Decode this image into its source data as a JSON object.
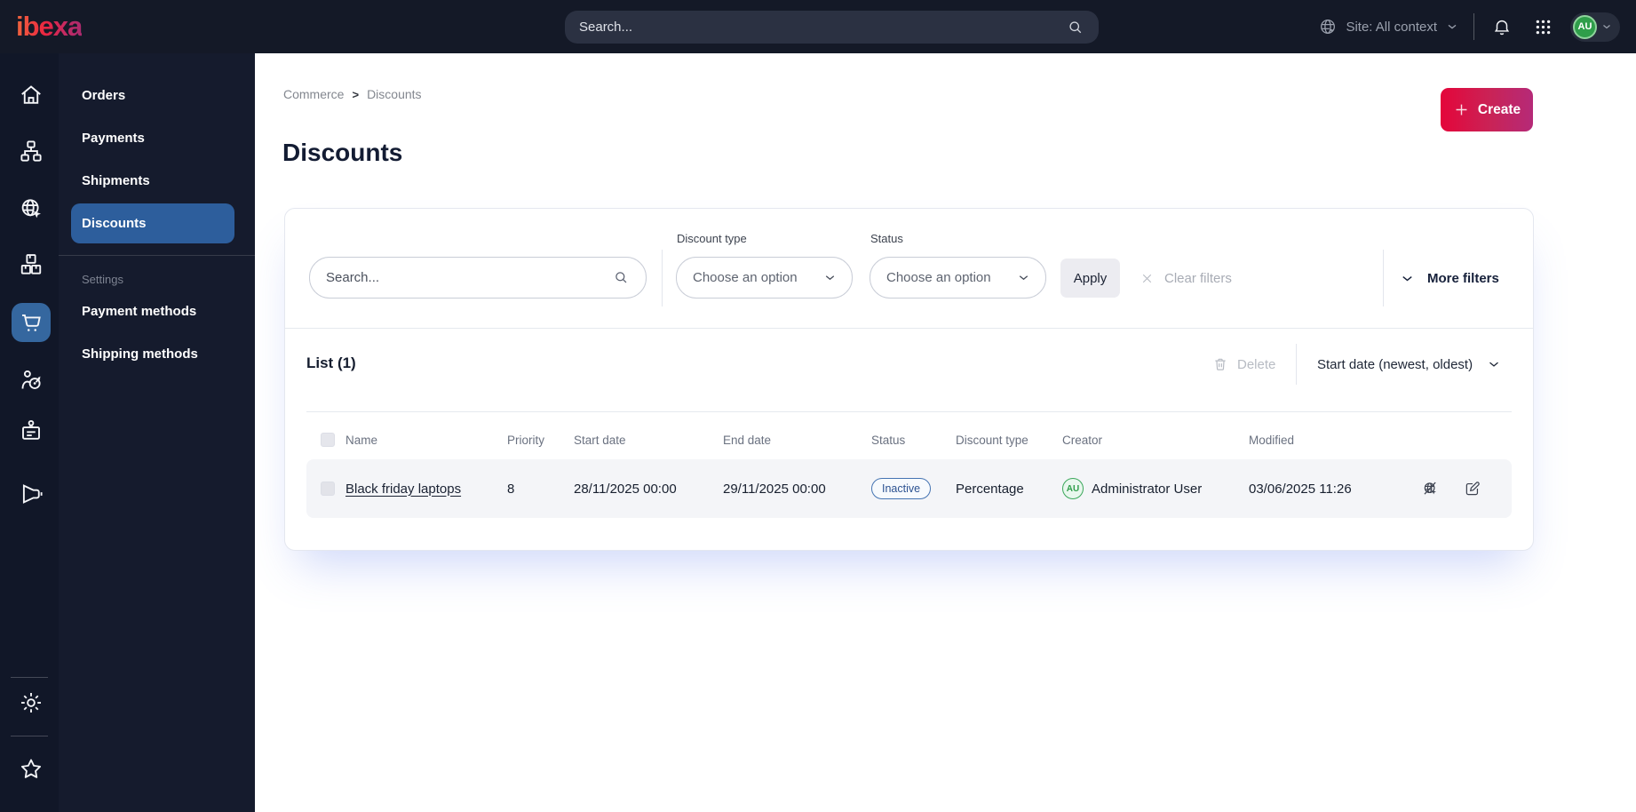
{
  "topbar": {
    "logo_text": "ibexa",
    "search_placeholder": "Search...",
    "site_context_label": "Site: All context",
    "avatar_initials": "AU"
  },
  "rail": {
    "icons": [
      "home",
      "content-tree",
      "site-globe",
      "products",
      "commerce-cart",
      "customers-target",
      "id-badge",
      "megaphone",
      "settings-gear",
      "bookmarks-star"
    ],
    "active_icon": "commerce-cart"
  },
  "menu": {
    "items": [
      {
        "label": "Orders",
        "active": false
      },
      {
        "label": "Payments",
        "active": false
      },
      {
        "label": "Shipments",
        "active": false
      },
      {
        "label": "Discounts",
        "active": true
      }
    ],
    "section_label": "Settings",
    "section_items": [
      {
        "label": "Payment methods"
      },
      {
        "label": "Shipping methods"
      }
    ]
  },
  "breadcrumb": {
    "item1": "Commerce",
    "separator": ">",
    "item2": "Discounts"
  },
  "page": {
    "title": "Discounts",
    "create_label": "Create"
  },
  "filters": {
    "search_placeholder": "Search...",
    "discount_type_label": "Discount type",
    "discount_type_value": "Choose an option",
    "status_label": "Status",
    "status_value": "Choose an option",
    "apply_label": "Apply",
    "clear_label": "Clear filters",
    "more_label": "More filters"
  },
  "list": {
    "title": "List (1)",
    "delete_label": "Delete",
    "sort_label": "Start date (newest, oldest)",
    "columns": [
      "Name",
      "Priority",
      "Start date",
      "End date",
      "Status",
      "Discount type",
      "Creator",
      "Modified"
    ],
    "rows": [
      {
        "name": "Black friday laptops",
        "priority": "8",
        "start_date": "28/11/2025 00:00",
        "end_date": "29/11/2025 00:00",
        "status": "Inactive",
        "discount_type": "Percentage",
        "creator": "Administrator User",
        "creator_initials": "AU",
        "modified": "03/06/2025 11:26"
      }
    ]
  },
  "colors": {
    "brand_red": "#e4063a",
    "brand_magenta": "#b52a78",
    "active_blue": "#2d5e9c",
    "status_inactive": "#2c5291",
    "avatar_green": "#2f9e4a",
    "topbar_bg": "#141927"
  }
}
